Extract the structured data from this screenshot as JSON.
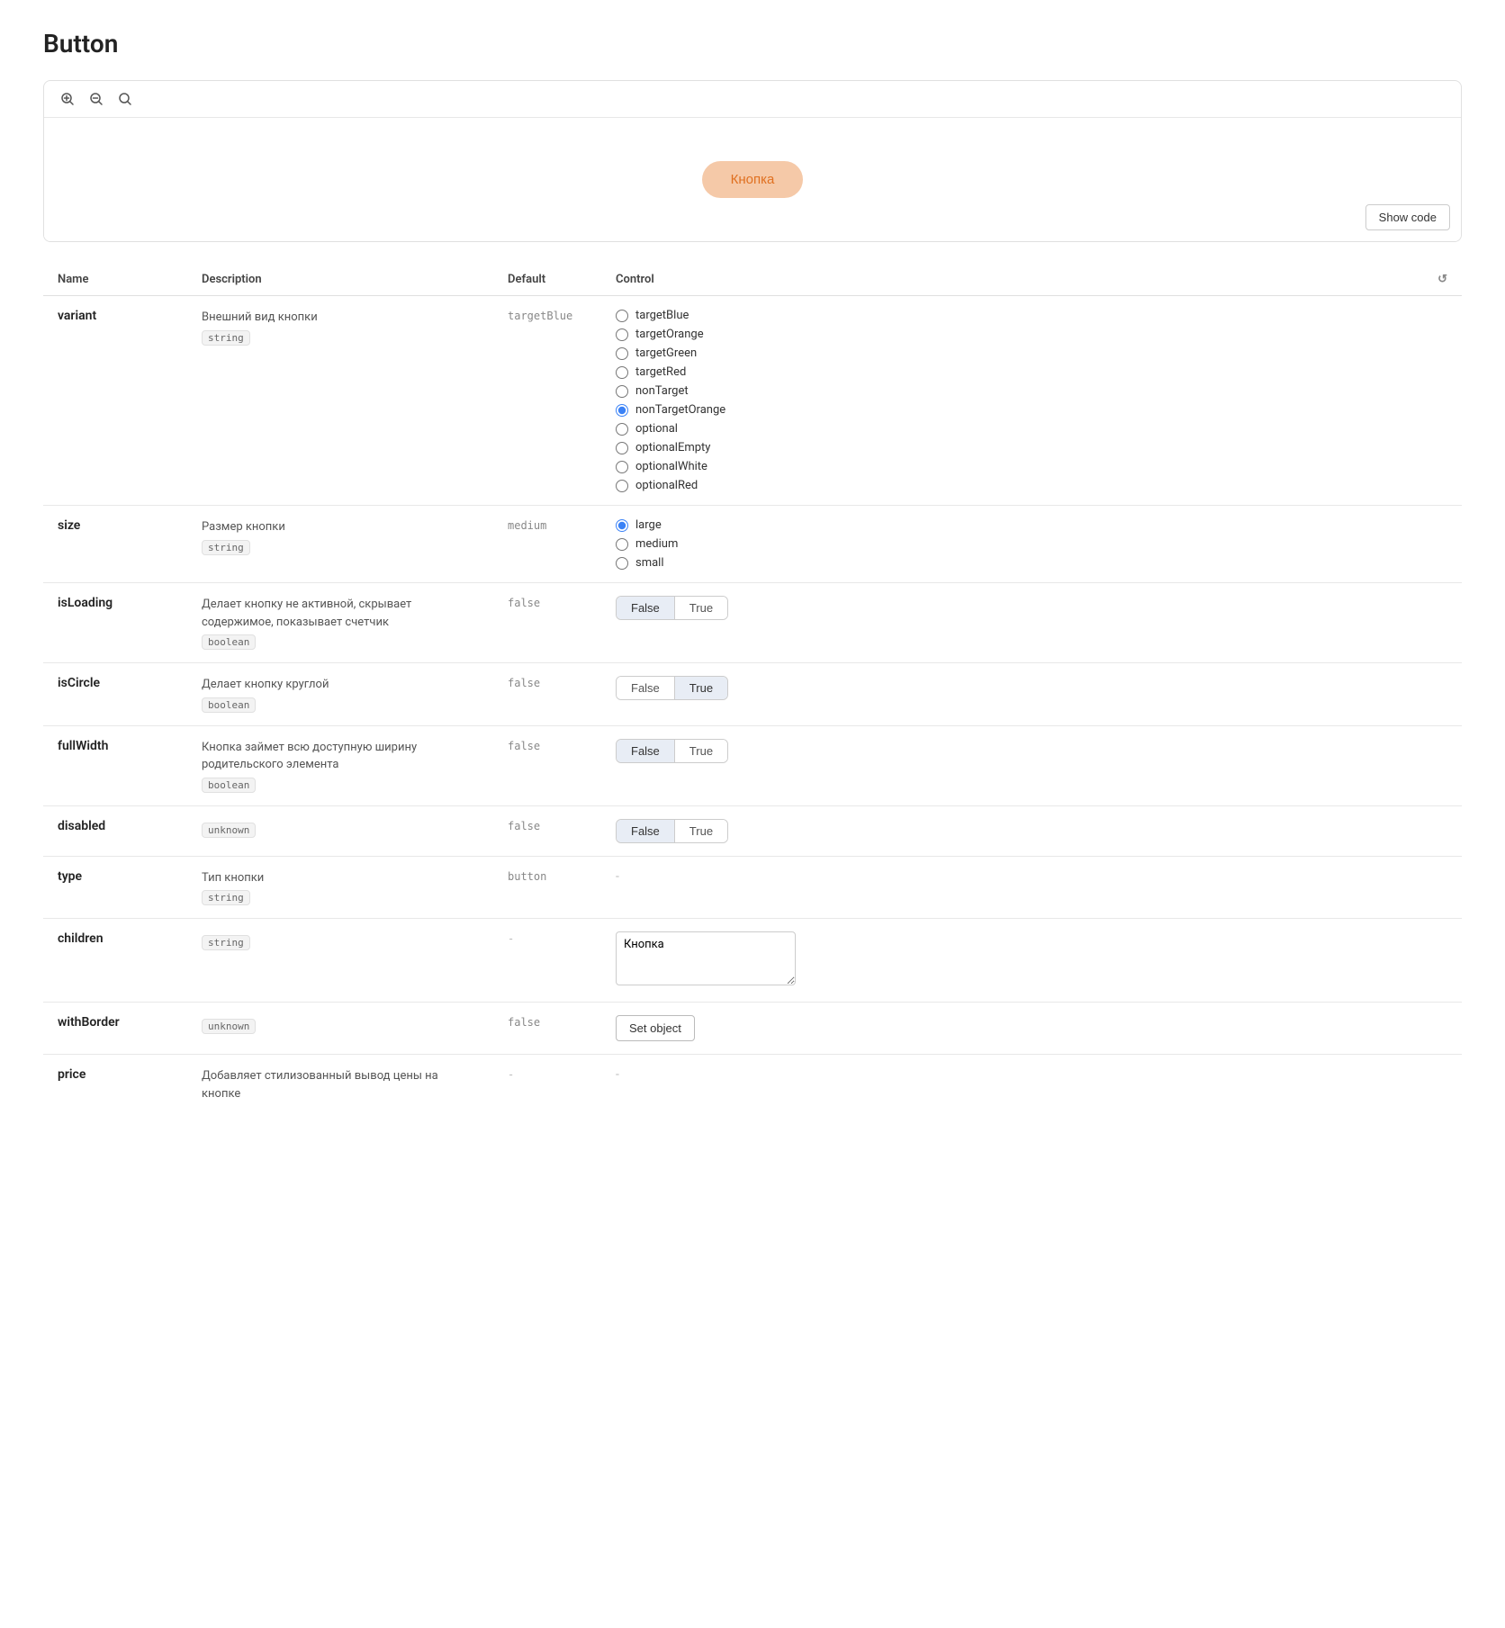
{
  "page": {
    "title": "Button"
  },
  "preview": {
    "button_label": "Кнопка",
    "show_code_label": "Show code"
  },
  "toolbar": {
    "zoom_in_icon": "+🔍",
    "zoom_out_icon": "−🔍",
    "reset_zoom_icon": "🔍"
  },
  "table": {
    "headers": {
      "name": "Name",
      "description": "Description",
      "default": "Default",
      "control": "Control"
    },
    "rows": [
      {
        "name": "variant",
        "description": "Внешний вид кнопки",
        "type": "string",
        "default": "targetBlue",
        "control_type": "radio",
        "options": [
          {
            "value": "targetBlue",
            "checked": false
          },
          {
            "value": "targetOrange",
            "checked": false
          },
          {
            "value": "targetGreen",
            "checked": false
          },
          {
            "value": "targetRed",
            "checked": false
          },
          {
            "value": "nonTarget",
            "checked": false
          },
          {
            "value": "nonTargetOrange",
            "checked": true
          },
          {
            "value": "optional",
            "checked": false
          },
          {
            "value": "optionalEmpty",
            "checked": false
          },
          {
            "value": "optionalWhite",
            "checked": false
          },
          {
            "value": "optionalRed",
            "checked": false
          }
        ]
      },
      {
        "name": "size",
        "description": "Размер кнопки",
        "type": "string",
        "default": "medium",
        "control_type": "radio",
        "options": [
          {
            "value": "large",
            "checked": true
          },
          {
            "value": "medium",
            "checked": false
          },
          {
            "value": "small",
            "checked": false
          }
        ]
      },
      {
        "name": "isLoading",
        "description": "Делает кнопку не активной, скрывает содержимое, показывает счетчик",
        "type": "boolean",
        "default": "false",
        "control_type": "toggle",
        "options": [
          {
            "label": "False",
            "active": true
          },
          {
            "label": "True",
            "active": false
          }
        ]
      },
      {
        "name": "isCircle",
        "description": "Делает кнопку круглой",
        "type": "boolean",
        "default": "false",
        "control_type": "toggle",
        "options": [
          {
            "label": "False",
            "active": false
          },
          {
            "label": "True",
            "active": true
          }
        ]
      },
      {
        "name": "fullWidth",
        "description": "Кнопка займет всю доступную ширину родительского элемента",
        "type": "boolean",
        "default": "false",
        "control_type": "toggle",
        "options": [
          {
            "label": "False",
            "active": true
          },
          {
            "label": "True",
            "active": false
          }
        ]
      },
      {
        "name": "disabled",
        "description": "",
        "type": "unknown",
        "default": "false",
        "control_type": "toggle",
        "options": [
          {
            "label": "False",
            "active": true
          },
          {
            "label": "True",
            "active": false
          }
        ]
      },
      {
        "name": "type",
        "description": "Тип кнопки",
        "type": "string",
        "default": "button",
        "control_type": "dash"
      },
      {
        "name": "children",
        "description": "",
        "type": "string",
        "default": "-",
        "control_type": "textarea",
        "textarea_value": "Кнопка"
      },
      {
        "name": "withBorder",
        "description": "",
        "type": "unknown",
        "default": "false",
        "control_type": "set_object",
        "set_object_label": "Set object"
      },
      {
        "name": "price",
        "description": "Добавляет стилизованный вывод цены на кнопке",
        "type": "",
        "default": "-",
        "control_type": "dash"
      }
    ]
  }
}
